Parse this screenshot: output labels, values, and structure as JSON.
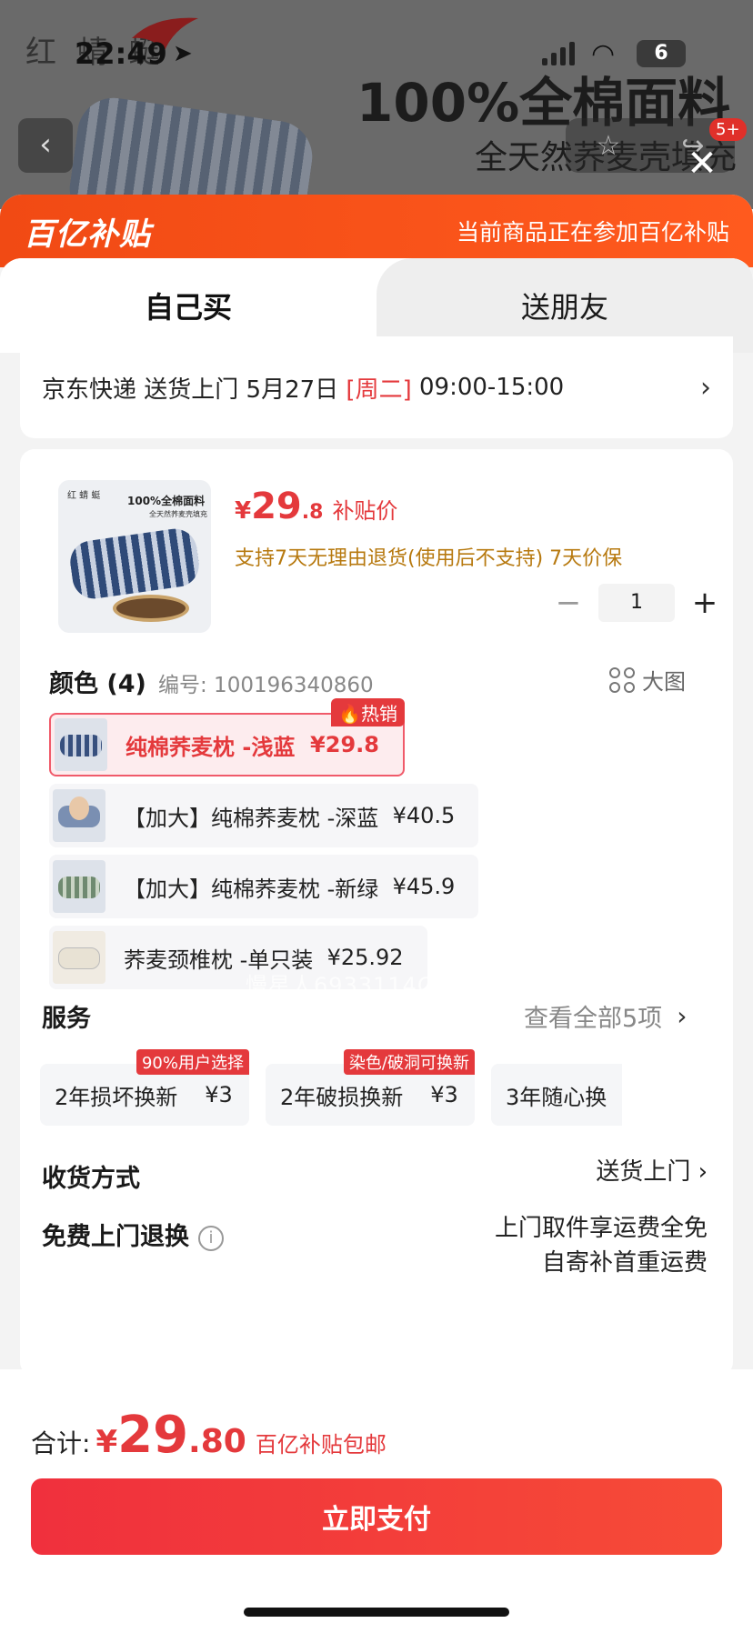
{
  "status_bar": {
    "time": "22:49",
    "battery": "6"
  },
  "background_page": {
    "brand": "红 蜻 蜓",
    "headline": "100%全棉面料",
    "subheadline": "全天然荞麦壳填充",
    "nav_badge": "5+"
  },
  "subsidy": {
    "logo": "百亿补贴",
    "note": "当前商品正在参加百亿补贴"
  },
  "tabs": [
    {
      "label": "自己买"
    },
    {
      "label": "送朋友"
    }
  ],
  "delivery": {
    "carrier": "京东快递 送货上门 5月27日",
    "weekday": "[周二]",
    "time_window": "09:00-15:00"
  },
  "product": {
    "image_brand": "红 蜻 蜓",
    "image_headline": "100%全棉面料",
    "image_sub": "全天然荞麦壳填充",
    "price_symbol": "¥",
    "price_int": "29",
    "price_dec": ".8",
    "price_tag": "补贴价",
    "return_policy": "支持7天无理由退货(使用后不支持)  7天价保",
    "quantity": "1"
  },
  "colors": {
    "heading": "颜色 (4)",
    "sku": "编号: 100196340860",
    "big_image": "大图",
    "options": [
      {
        "label": "纯棉荞麦枕 -浅蓝",
        "price": "¥29.8",
        "badge": "热销"
      },
      {
        "label": "【加大】纯棉荞麦枕 -深蓝",
        "price": "¥40.5"
      },
      {
        "label": "【加大】纯棉荞麦枕 -新绿",
        "price": "¥45.9"
      },
      {
        "label": "荞麦颈椎枕 -单只装",
        "price": "¥25.92"
      }
    ]
  },
  "watermark": "慢星人6933114OA",
  "services": {
    "heading": "服务",
    "more": "查看全部5项",
    "items": [
      {
        "label": "2年损坏换新",
        "price": "¥3",
        "badge": "90%用户选择"
      },
      {
        "label": "2年破损换新",
        "price": "¥3",
        "badge": "染色/破洞可换新"
      },
      {
        "label": "3年随心换",
        "price": ""
      }
    ]
  },
  "shipping": {
    "label": "收货方式",
    "value": "送货上门"
  },
  "free_return": {
    "label": "免费上门退换",
    "line1": "上门取件享运费全免",
    "line2": "自寄补首重运费"
  },
  "footer": {
    "total_label": "合计:",
    "total_symbol": "¥",
    "total_int": "29",
    "total_dec": ".80",
    "total_note": "百亿补贴包邮",
    "pay_button": "立即支付"
  }
}
